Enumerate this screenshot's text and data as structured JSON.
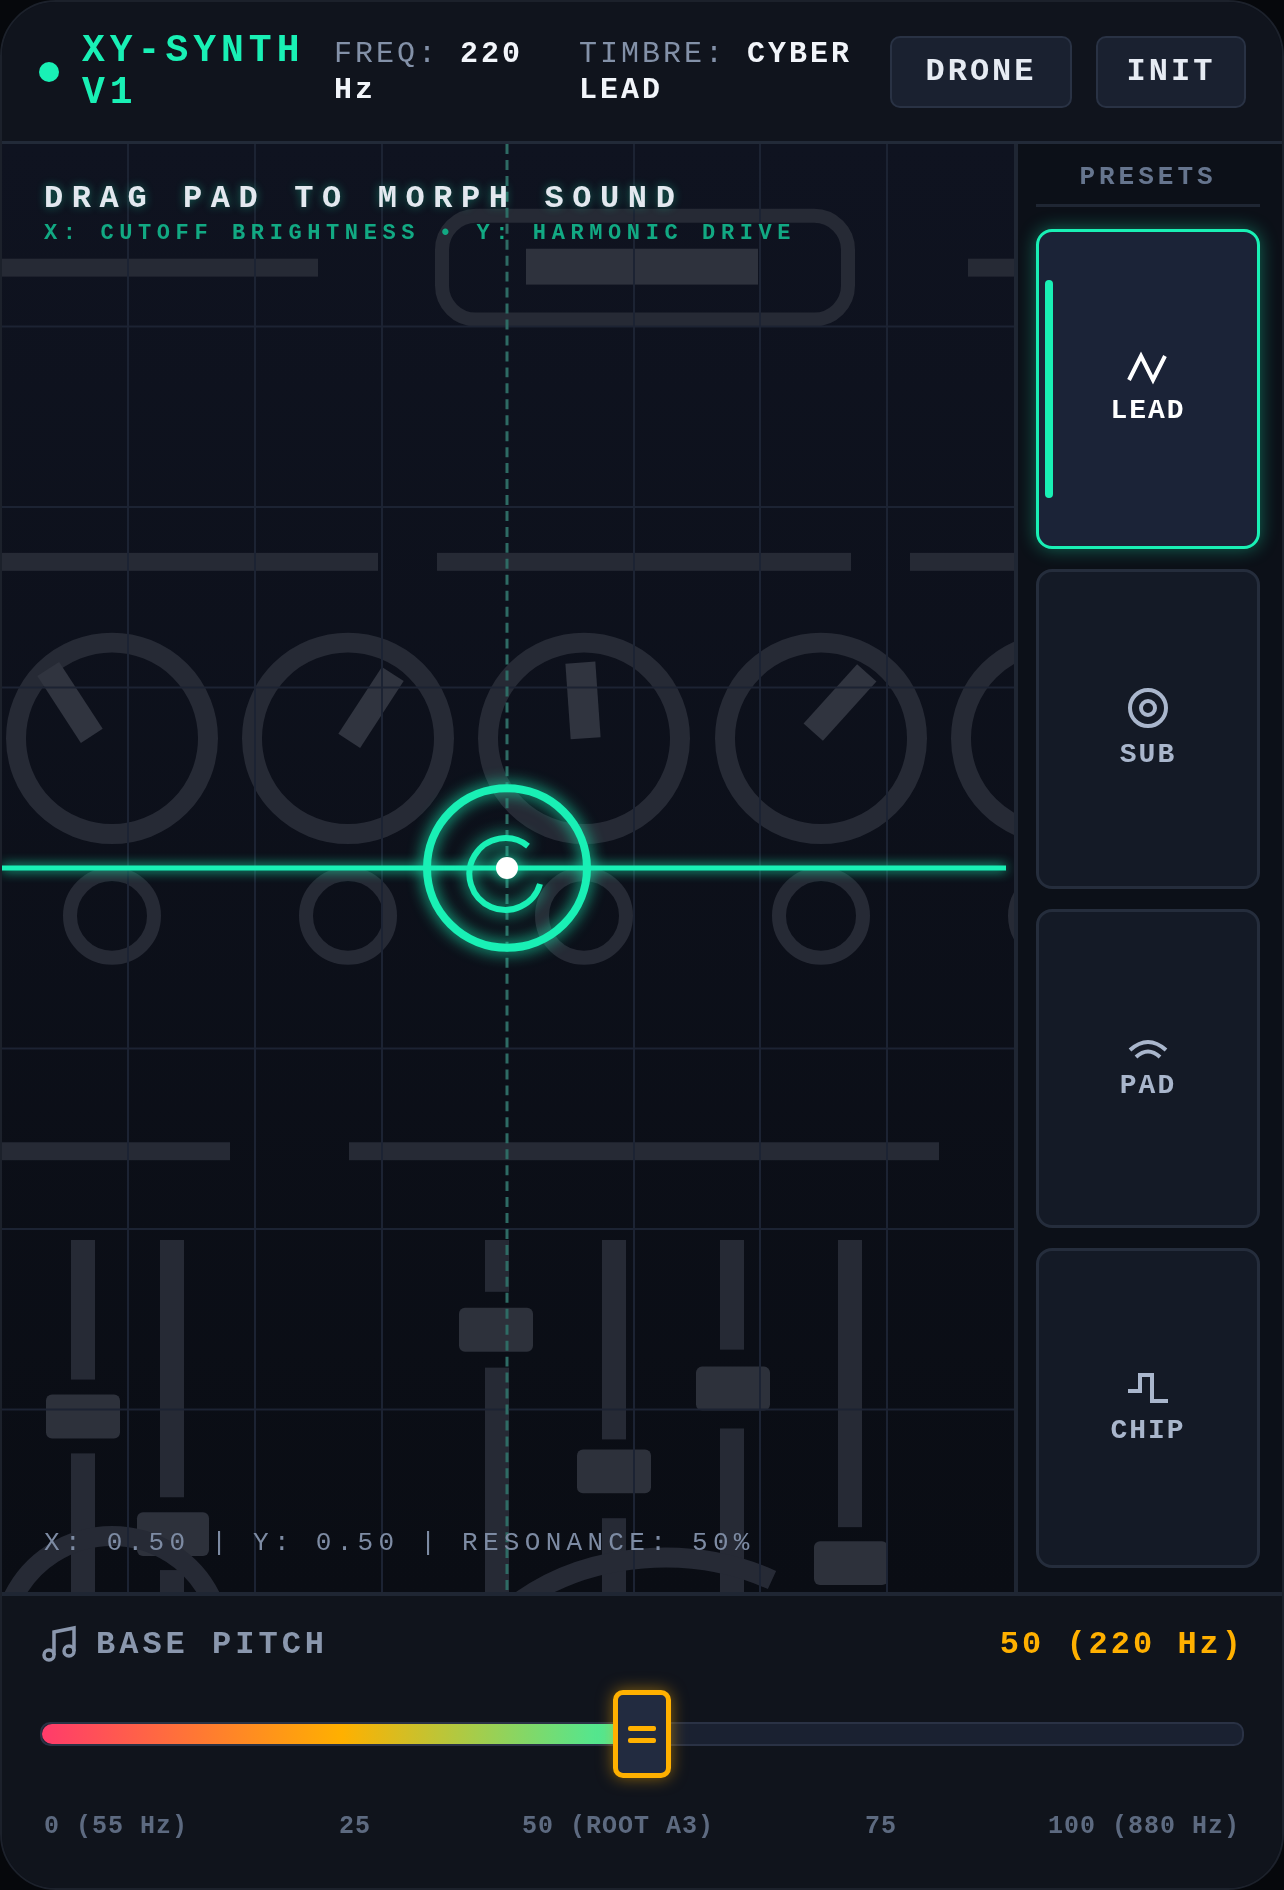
{
  "header": {
    "title": "XY-SYNTH V1",
    "freq_label": "FREQ:",
    "freq_value": "220 Hz",
    "timbre_label": "TIMBRE:",
    "timbre_value": "CYBER LEAD",
    "buttons": [
      "DRONE",
      "INIT"
    ]
  },
  "pad": {
    "title": "DRAG PAD TO MORPH SOUND",
    "subtitle": "X: CUTOFF BRIGHTNESS • Y: HARMONIC DRIVE",
    "readout": "X: 0.50 | Y: 0.50 | RESONANCE: 50%"
  },
  "presets": {
    "heading": "PRESETS",
    "items": [
      {
        "label": "LEAD",
        "kind": "zigzag",
        "selected": true
      },
      {
        "label": "SUB",
        "kind": "rings",
        "selected": false
      },
      {
        "label": "PAD",
        "kind": "arcs",
        "selected": false
      },
      {
        "label": "CHIP",
        "kind": "step",
        "selected": false
      }
    ]
  },
  "pitch": {
    "label": "BASE PITCH",
    "reading": "50 (220 Hz)",
    "level": 0.5,
    "ticks": [
      "0 (55 Hz)",
      "25",
      "50 (ROOT A3)",
      "75",
      "100 (880 Hz)"
    ]
  }
}
